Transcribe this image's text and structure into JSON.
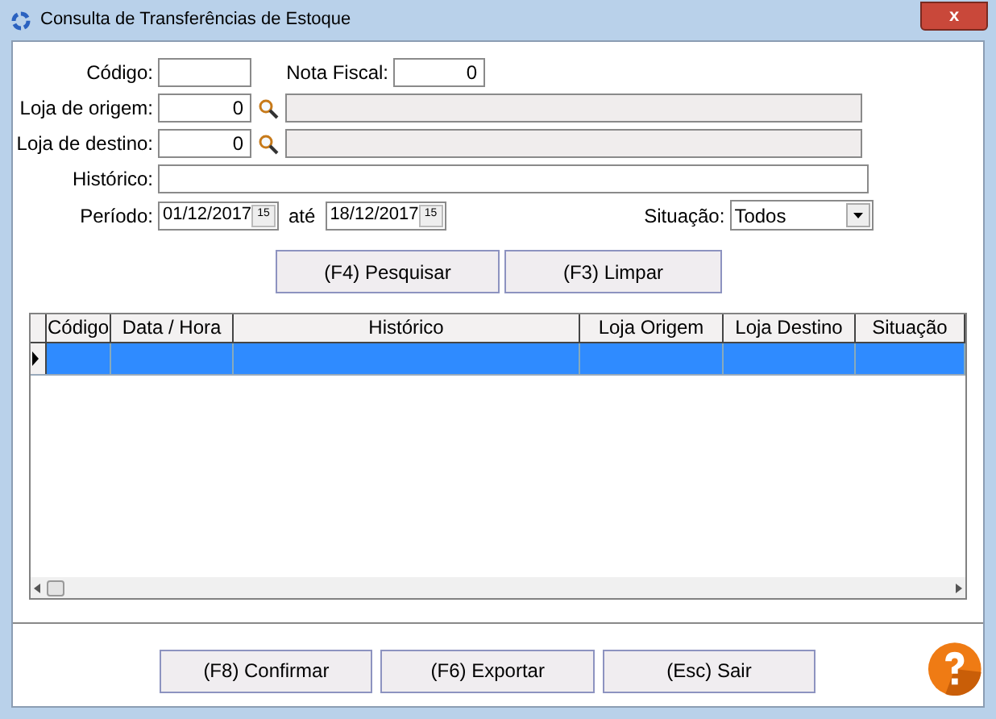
{
  "window": {
    "title": "Consulta de Transferências de Estoque",
    "close": "x"
  },
  "form": {
    "codigo": {
      "label": "Código:"
    },
    "nota_fiscal": {
      "label": "Nota Fiscal:",
      "value": "0"
    },
    "loja_origem": {
      "label": "Loja de origem:",
      "value": "0"
    },
    "loja_destino": {
      "label": "Loja de destino:",
      "value": "0"
    },
    "historico": {
      "label": "Histórico:"
    },
    "periodo": {
      "label": "Período:",
      "from": "01/12/2017",
      "from_calendar": "15",
      "to_label": "até",
      "to": "18/12/2017",
      "to_calendar": "15"
    },
    "situacao": {
      "label": "Situação:",
      "value": "Todos"
    }
  },
  "search_buttons": [
    "(F4) Pesquisar",
    "(F3) Limpar"
  ],
  "table": {
    "columns": [
      "Código",
      "Data / Hora",
      "Histórico",
      "Loja Origem",
      "Loja Destino",
      "Situação"
    ],
    "rows": [
      {
        "selected": true
      }
    ]
  },
  "footer_buttons": [
    "(F8) Confirmar",
    "(F6) Exportar",
    "(Esc) Sair"
  ]
}
